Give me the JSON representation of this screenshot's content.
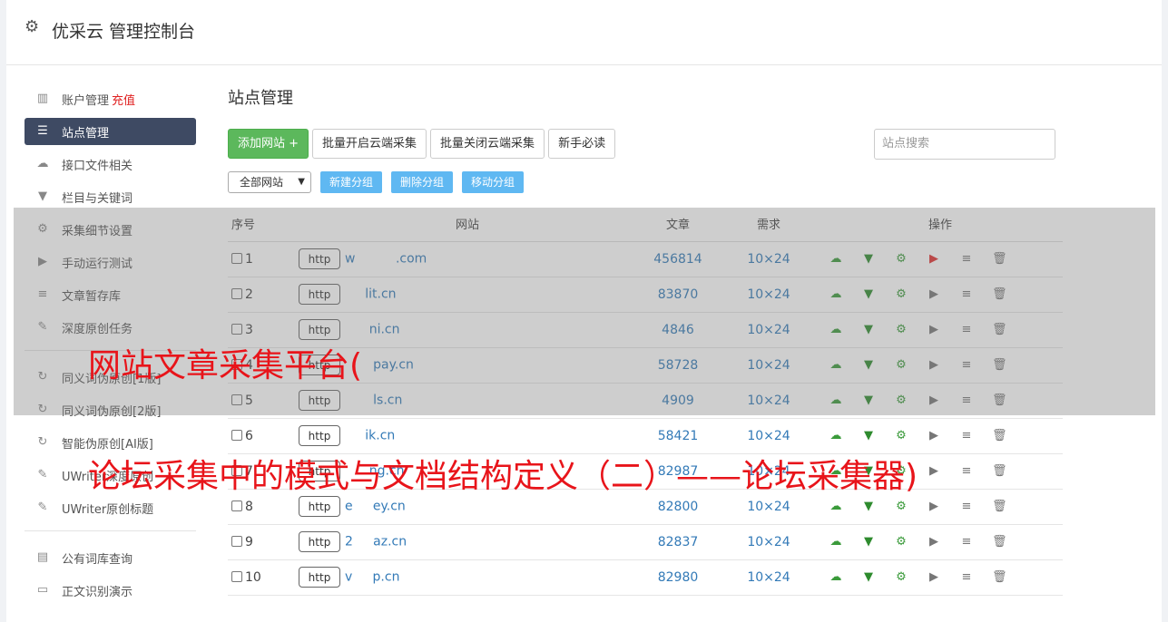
{
  "header": {
    "title": "优采云 管理控制台",
    "icon": "gear-icon"
  },
  "sidebar": {
    "group1": [
      {
        "label": "账户管理",
        "tag": "充值",
        "icon": "bar-chart-icon"
      },
      {
        "label": "站点管理",
        "icon": "server-icon",
        "active": true
      },
      {
        "label": "接口文件相关",
        "icon": "cloud-icon"
      },
      {
        "label": "栏目与关键词",
        "icon": "filter-icon"
      },
      {
        "label": "采集细节设置",
        "icon": "gears-icon"
      },
      {
        "label": "手动运行测试",
        "icon": "play-icon"
      },
      {
        "label": "文章暂存库",
        "icon": "database-icon"
      },
      {
        "label": "深度原创任务",
        "icon": "edit-icon"
      }
    ],
    "group2": [
      {
        "label": "同义词伪原创[1版]",
        "icon": "refresh-icon"
      },
      {
        "label": "同义词伪原创[2版]",
        "icon": "refresh-icon"
      },
      {
        "label": "智能伪原创[AI版]",
        "icon": "refresh-icon"
      },
      {
        "label": "UWriter深度原创",
        "icon": "edit-icon"
      },
      {
        "label": "UWriter原创标题",
        "icon": "edit-icon"
      }
    ],
    "group3": [
      {
        "label": "公有词库查询",
        "icon": "book-icon"
      },
      {
        "label": "正文识别演示",
        "icon": "monitor-icon"
      }
    ]
  },
  "main": {
    "title": "站点管理",
    "buttons": {
      "add": "添加网站 +",
      "batch_open": "批量开启云端采集",
      "batch_close": "批量关闭云端采集",
      "guide": "新手必读"
    },
    "search_placeholder": "站点搜索",
    "group_select": "全部网站",
    "group_buttons": {
      "new": "新建分组",
      "delete": "删除分组",
      "move": "移动分组"
    },
    "table": {
      "headers": {
        "seq": "序号",
        "site": "网站",
        "articles": "文章",
        "demand": "需求",
        "ops": "操作"
      },
      "rows": [
        {
          "seq": "1",
          "proto": "http",
          "site": "w          .com",
          "articles": "456814",
          "demand": "10×24",
          "run_active": true
        },
        {
          "seq": "2",
          "proto": "http",
          "site": "     lit.cn",
          "articles": "83870",
          "demand": "10×24"
        },
        {
          "seq": "3",
          "proto": "http",
          "site": "      ni.cn",
          "articles": "4846",
          "demand": "10×24"
        },
        {
          "seq": "4",
          "proto": "http",
          "site": "       pay.cn",
          "articles": "58728",
          "demand": "10×24"
        },
        {
          "seq": "5",
          "proto": "http",
          "site": "       ls.cn",
          "articles": "4909",
          "demand": "10×24"
        },
        {
          "seq": "6",
          "proto": "http",
          "site": "     ik.cn",
          "articles": "58421",
          "demand": "10×24"
        },
        {
          "seq": "7",
          "proto": "http",
          "site": "      ng.cn",
          "articles": "82987",
          "demand": "10×24"
        },
        {
          "seq": "8",
          "proto": "http",
          "site": "e     ey.cn",
          "articles": "82800",
          "demand": "10×24"
        },
        {
          "seq": "9",
          "proto": "http",
          "site": "2     az.cn",
          "articles": "82837",
          "demand": "10×24"
        },
        {
          "seq": "10",
          "proto": "http",
          "site": "v     p.cn",
          "articles": "82980",
          "demand": "10×24"
        }
      ]
    }
  },
  "overlay": {
    "line1": "网站文章采集平台(",
    "line2": "论坛采集中的模式与文档结构定义（二）——论坛采集器)",
    "color": "#e8141a"
  }
}
